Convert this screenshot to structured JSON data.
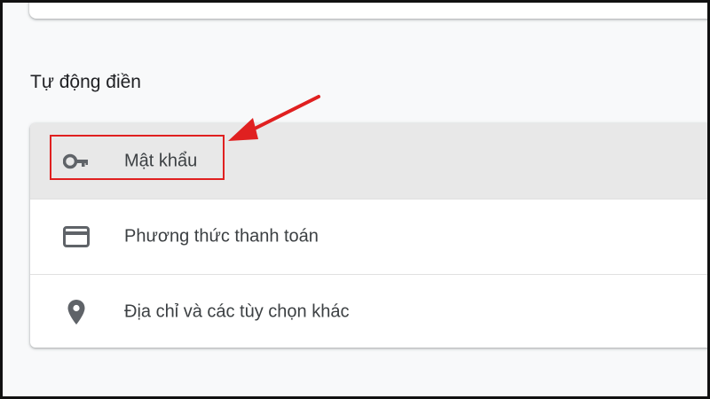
{
  "top_section": {},
  "autofill": {
    "title": "Tự động điền",
    "items": [
      {
        "label": "Mật khẩu",
        "icon": "key-icon",
        "active": true
      },
      {
        "label": "Phương thức thanh toán",
        "icon": "credit-card-icon",
        "active": false
      },
      {
        "label": "Địa chỉ và các tùy chọn khác",
        "icon": "location-pin-icon",
        "active": false
      }
    ]
  },
  "annotation": {
    "color": "#e02020",
    "target": "Mật khẩu"
  },
  "colors": {
    "background": "#f8f9fa",
    "card": "#ffffff",
    "active_row": "#e8e8e8",
    "text": "#3c4043",
    "icon": "#5f6368",
    "frame_border": "#111111"
  }
}
